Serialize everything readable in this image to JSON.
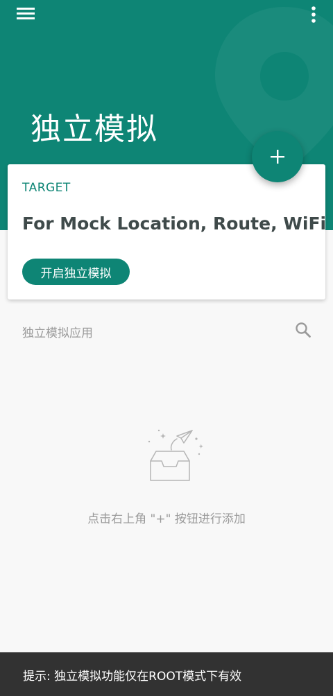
{
  "header": {
    "title": "独立模拟",
    "menu_icon": "hamburger-menu-icon",
    "more_icon": "more-vert-icon",
    "background_color": "#0e8575"
  },
  "fab": {
    "icon": "plus-icon"
  },
  "target_card": {
    "label": "TARGET",
    "target": "For Mock Location, Route, WiFi",
    "start_button_label": "开启独立模拟"
  },
  "apps_section": {
    "title": "独立模拟应用",
    "search_icon": "search-icon"
  },
  "empty_state": {
    "illustration": "empty-inbox-illustration",
    "hint": "点击右上角 \"+\" 按钮进行添加"
  },
  "snackbar": {
    "message": "提示: 独立模拟功能仅在ROOT模式下有效"
  },
  "colors": {
    "accent": "#0e8575",
    "snackbar_bg": "#323232",
    "text_secondary": "#9a9a9a"
  }
}
